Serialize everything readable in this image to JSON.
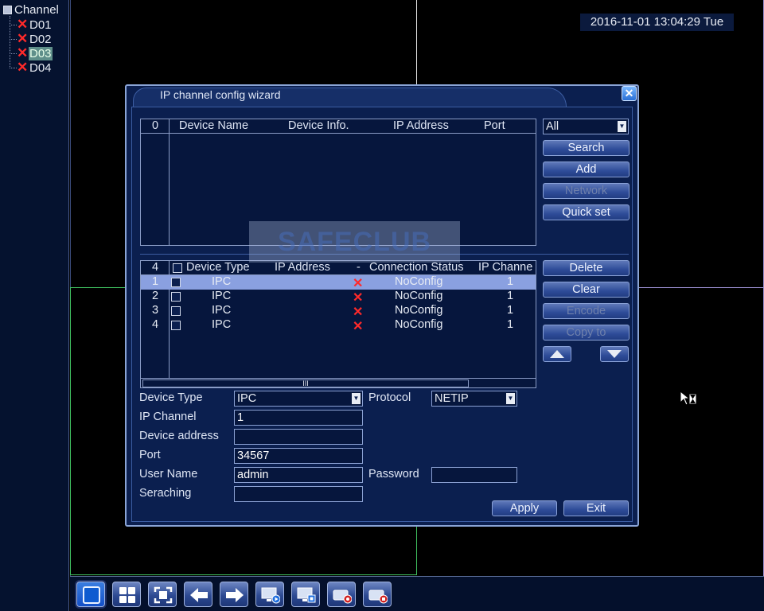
{
  "tree": {
    "root_label": "Channel",
    "channels": [
      {
        "label": "D01",
        "status": "disconnected"
      },
      {
        "label": "D02",
        "status": "disconnected"
      },
      {
        "label": "D03",
        "status": "disconnected",
        "selected": true
      },
      {
        "label": "D04",
        "status": "disconnected"
      }
    ]
  },
  "timestamp": "2016-11-01 13:04:29 Tue",
  "dialog": {
    "title": "IP channel config wizard",
    "close_icon": "close-icon",
    "search_list": {
      "count": "0",
      "headers": [
        "Device Name",
        "Device Info.",
        "IP Address",
        "Port"
      ],
      "filter_value": "All"
    },
    "side_buttons_top": [
      {
        "label": "Search",
        "enabled": true
      },
      {
        "label": "Add",
        "enabled": true
      },
      {
        "label": "Network",
        "enabled": false
      },
      {
        "label": "Quick set",
        "enabled": true
      }
    ],
    "channel_list": {
      "count": "4",
      "headers": [
        "Device Type",
        "IP Address",
        "-",
        "Connection Status",
        "IP Channe"
      ],
      "rows": [
        {
          "index": "1",
          "device_type": "IPC",
          "status": "NoConfig",
          "ip_channel": "1",
          "selected": true
        },
        {
          "index": "2",
          "device_type": "IPC",
          "status": "NoConfig",
          "ip_channel": "1"
        },
        {
          "index": "3",
          "device_type": "IPC",
          "status": "NoConfig",
          "ip_channel": "1"
        },
        {
          "index": "4",
          "device_type": "IPC",
          "status": "NoConfig",
          "ip_channel": "1"
        }
      ],
      "scroll_thumb": "III"
    },
    "side_buttons_bottom": [
      {
        "label": "Delete",
        "enabled": true
      },
      {
        "label": "Clear",
        "enabled": true
      },
      {
        "label": "Encode",
        "enabled": false
      },
      {
        "label": "Copy to",
        "enabled": false
      }
    ],
    "form": {
      "device_type_label": "Device Type",
      "device_type_value": "IPC",
      "protocol_label": "Protocol",
      "protocol_value": "NETIP",
      "ip_channel_label": "IP Channel",
      "ip_channel_value": "1",
      "device_address_label": "Device address",
      "device_address_value": "",
      "port_label": "Port",
      "port_value": "34567",
      "user_name_label": "User Name",
      "user_name_value": "admin",
      "password_label": "Password",
      "password_value": "",
      "searching_label": "Seraching",
      "searching_value": ""
    },
    "apply_label": "Apply",
    "exit_label": "Exit"
  },
  "watermark": "SAFECLUB",
  "taskbar": [
    "single-view-icon",
    "quad-view-icon",
    "fullscreen-icon",
    "previous-icon",
    "next-icon",
    "monitor-play-icon",
    "monitor-settings-icon",
    "record-icon",
    "stop-record-icon"
  ],
  "colors": {
    "dialog_bg": "#0b1f4f",
    "selected_row": "#8aa0e0",
    "error_x": "#ff2a2a",
    "grid_green": "#3fbf5f",
    "grid_lavender": "#9a8fd0"
  }
}
